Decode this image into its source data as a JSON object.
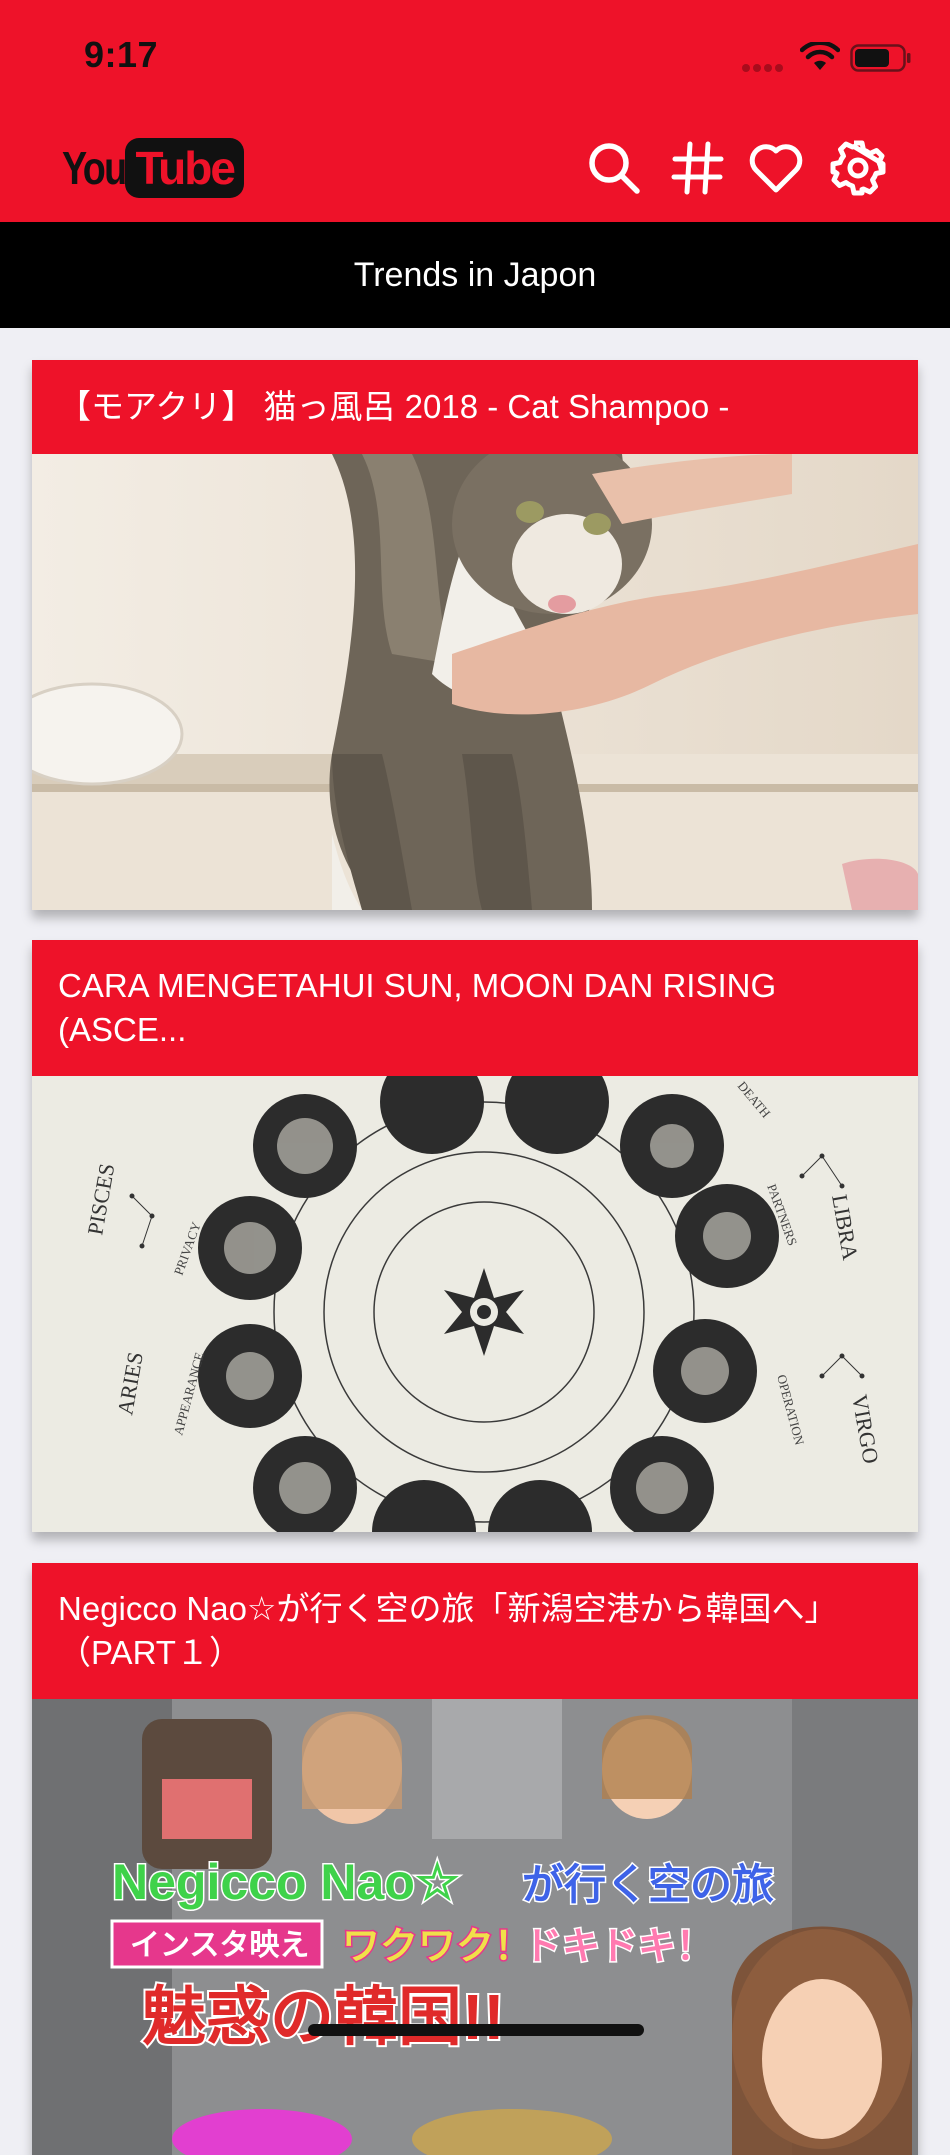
{
  "status": {
    "time": "9:17"
  },
  "header": {
    "logo_you": "You",
    "logo_tube": "Tube",
    "subtitle": "Trends in Japon"
  },
  "icons": [
    "search-icon",
    "hashtag-icon",
    "heart-icon",
    "settings-icon"
  ],
  "colors": {
    "brand": "#EE1229",
    "header_black": "#000000",
    "background": "#EFEFF4"
  },
  "videos": [
    {
      "title": "【モアクリ】 猫っ風呂 2018 - Cat Shampoo -",
      "thumbnail": "cat-bath-thumbnail"
    },
    {
      "title": "CARA MENGETAHUI SUN, MOON DAN RISING (ASCE...",
      "thumbnail": "zodiac-wheel-thumbnail"
    },
    {
      "title": "Negicco Nao☆が行く空の旅「新潟空港から韓国へ」（PART１）",
      "thumbnail": "negicco-travel-thumbnail",
      "thumb_text": {
        "line1": "Negicco Nao☆",
        "line1b": "が行く空の旅",
        "tag1": "インスタ映え",
        "tag2": "ワクワク！",
        "tag3": "ドキドキ！",
        "line3": "魅惑の韓国!!"
      }
    }
  ]
}
